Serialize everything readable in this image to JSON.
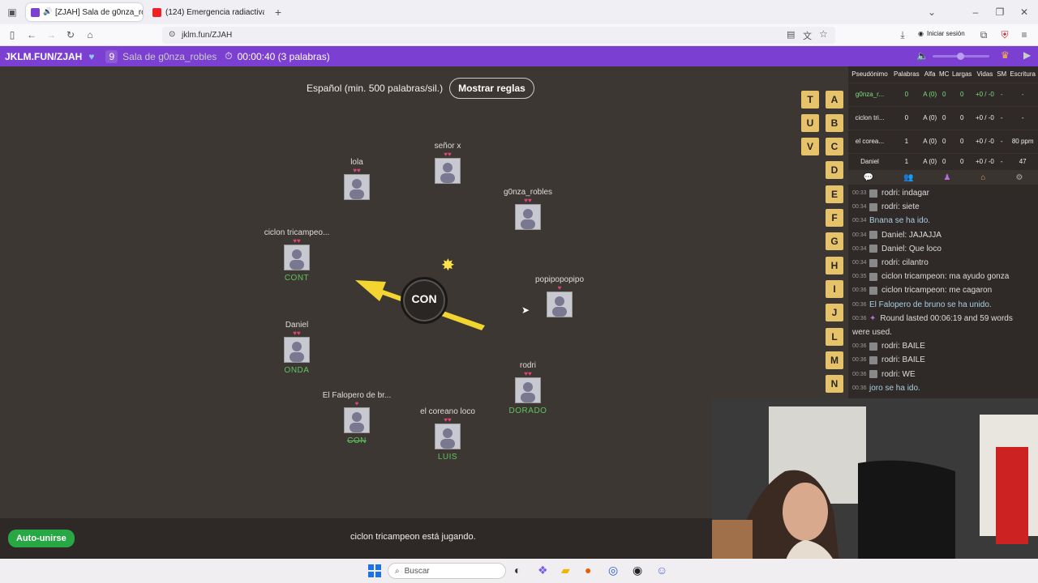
{
  "browser": {
    "tabs": [
      {
        "label": "[ZJAH] Sala de g0nza_roble",
        "active": true
      },
      {
        "label": "(124) Emergencia radiactiva ( 2(",
        "active": false
      }
    ],
    "url": "jklm.fun/ZJAH",
    "signin_label": "Iniciar sesión"
  },
  "header": {
    "site": "JKLM.FUN/ZJAH",
    "player_count": "9",
    "room": "Sala de g0nza_robles",
    "timer": "00:00:40 (3 palabras)"
  },
  "game": {
    "language": "Español (min. 500 palabras/sil.)",
    "rules_button": "Mostrar reglas",
    "syllable": "CON",
    "status": "ciclon tricampeon está jugando.",
    "autojoin": "Auto-unirse",
    "players": [
      {
        "name": "lola",
        "hearts": "♥♥",
        "word": ""
      },
      {
        "name": "señor x",
        "hearts": "♥♥",
        "word": ""
      },
      {
        "name": "g0nza_robles",
        "hearts": "♥♥",
        "word": ""
      },
      {
        "name": "ciclon tricampeo...",
        "hearts": "♥♥",
        "word": "CONT"
      },
      {
        "name": "popipopopipo",
        "hearts": "♥",
        "word": ""
      },
      {
        "name": "Daniel",
        "hearts": "♥♥",
        "word": "ONDA"
      },
      {
        "name": "rodri",
        "hearts": "♥♥",
        "word": "DORADO"
      },
      {
        "name": "El Falopero de br...",
        "hearts": "♥",
        "word": "CON"
      },
      {
        "name": "el coreano loco",
        "hearts": "♥♥",
        "word": "LUIS"
      }
    ]
  },
  "tiles": {
    "col1": [
      "T",
      "U",
      "V"
    ],
    "col2": [
      "A",
      "B",
      "C",
      "D",
      "E",
      "F",
      "G",
      "H",
      "I",
      "J",
      "L",
      "M",
      "N"
    ]
  },
  "table": {
    "headers": [
      "Pseudónimo",
      "Palabras",
      "Alfa",
      "MC",
      "Largas",
      "Vidas",
      "SM",
      "Escritura"
    ],
    "rows": [
      {
        "name": "g0nza_r...",
        "words": "0",
        "alfa": "A (0)",
        "mc": "0",
        "largas": "0",
        "vidas": "+0 / -0",
        "sm": "-",
        "esc": "-"
      },
      {
        "name": "ciclon tri...",
        "words": "0",
        "alfa": "A (0)",
        "mc": "0",
        "largas": "0",
        "vidas": "+0 / -0",
        "sm": "-",
        "esc": "-"
      },
      {
        "name": "el corea...",
        "words": "1",
        "alfa": "A (0)",
        "mc": "0",
        "largas": "0",
        "vidas": "+0 / -0",
        "sm": "-",
        "esc": "80 ppm"
      },
      {
        "name": "Daniel",
        "words": "1",
        "alfa": "A (0)",
        "mc": "0",
        "largas": "0",
        "vidas": "+0 / -0",
        "sm": "-",
        "esc": "47"
      }
    ]
  },
  "chat": [
    {
      "t": "00:33",
      "text": "rodri: indagar",
      "sys": false
    },
    {
      "t": "00:34",
      "text": "rodri: siete",
      "sys": false
    },
    {
      "t": "00:34",
      "text": "Bnana se ha ido.",
      "sys": true
    },
    {
      "t": "00:34",
      "text": "Daniel: JAJAJJA",
      "sys": false
    },
    {
      "t": "00:34",
      "text": "Daniel: Que loco",
      "sys": false
    },
    {
      "t": "00:34",
      "text": "rodri: cilantro",
      "sys": false
    },
    {
      "t": "00:35",
      "text": "ciclon tricampeon: ma ayudo gonza",
      "sys": false
    },
    {
      "t": "00:36",
      "text": "ciclon tricampeon: me cagaron",
      "sys": false
    },
    {
      "t": "00:36",
      "text": "El Falopero de bruno se ha unido.",
      "sys": true
    },
    {
      "t": "00:36",
      "text": "Round lasted 00:06:19 and 59 words",
      "sys": false
    },
    {
      "t": "",
      "text": "were used.",
      "sys": false
    },
    {
      "t": "00:36",
      "text": "rodri: BAILE",
      "sys": false
    },
    {
      "t": "00:36",
      "text": "rodri: BAILE",
      "sys": false
    },
    {
      "t": "00:36",
      "text": "rodri: WE",
      "sys": false
    },
    {
      "t": "00:36",
      "text": "joro se ha ido.",
      "sys": true
    }
  ],
  "taskbar": {
    "search_placeholder": "Buscar"
  },
  "colors": {
    "header": "#7b3fd1",
    "tile": "#e6c36a",
    "word_green": "#5ec35e",
    "heart": "#e0427a",
    "arrow": "#f2d530"
  }
}
